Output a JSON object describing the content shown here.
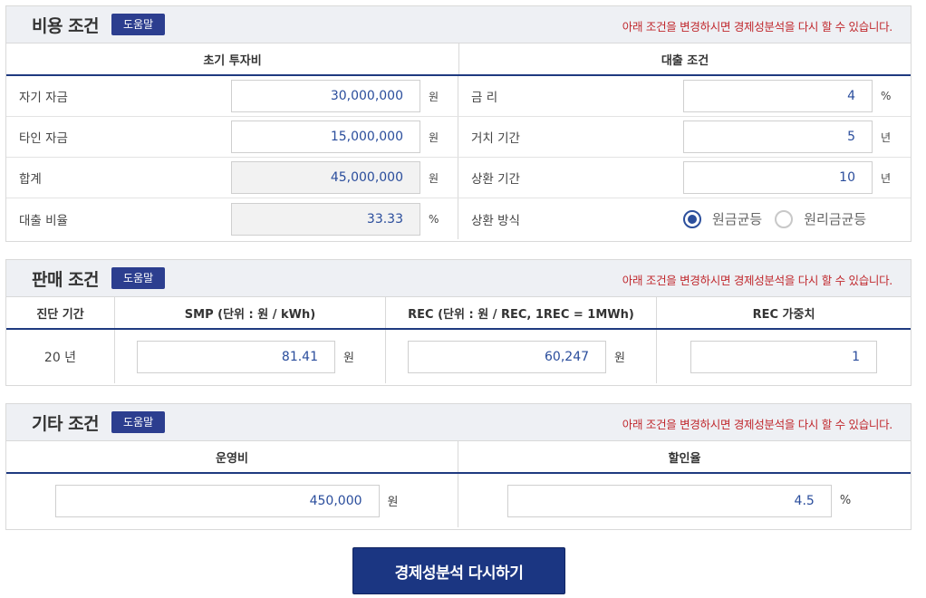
{
  "cost": {
    "title": "비용 조건",
    "help": "도움말",
    "notice": "아래 조건을 변경하시면 경제성분석을 다시 할 수 있습니다.",
    "left_header": "초기 투자비",
    "right_header": "대출 조건",
    "rows": [
      {
        "left_label": "자기 자금",
        "left_value": "30,000,000",
        "left_unit": "원",
        "right_label": "금 리",
        "right_value": "4",
        "right_unit": "%"
      },
      {
        "left_label": "타인 자금",
        "left_value": "15,000,000",
        "left_unit": "원",
        "right_label": "거치 기간",
        "right_value": "5",
        "right_unit": "년"
      },
      {
        "left_label": "합계",
        "left_value": "45,000,000",
        "left_unit": "원",
        "right_label": "상환 기간",
        "right_value": "10",
        "right_unit": "년"
      },
      {
        "left_label": "대출 비율",
        "left_value": "33.33",
        "left_unit": "%",
        "right_label": "상환 방식"
      }
    ],
    "repay_options": [
      {
        "label": "원금균등",
        "selected": true
      },
      {
        "label": "원리금균등",
        "selected": false
      }
    ]
  },
  "sales": {
    "title": "판매 조건",
    "help": "도움말",
    "notice": "아래 조건을 변경하시면 경제성분석을 다시 할 수 있습니다.",
    "headers": [
      "진단 기간",
      "SMP (단위 : 원 / kWh)",
      "REC (단위 : 원 / REC, 1REC = 1MWh)",
      "REC 가중치"
    ],
    "period": "20 년",
    "smp_value": "81.41",
    "smp_unit": "원",
    "rec_value": "60,247",
    "rec_unit": "원",
    "weight_value": "1"
  },
  "other": {
    "title": "기타 조건",
    "help": "도움말",
    "notice": "아래 조건을 변경하시면 경제성분석을 다시 할 수 있습니다.",
    "headers": [
      "운영비",
      "할인율"
    ],
    "opex_value": "450,000",
    "opex_unit": "원",
    "discount_value": "4.5",
    "discount_unit": "%"
  },
  "submit_label": "경제성분석 다시하기"
}
